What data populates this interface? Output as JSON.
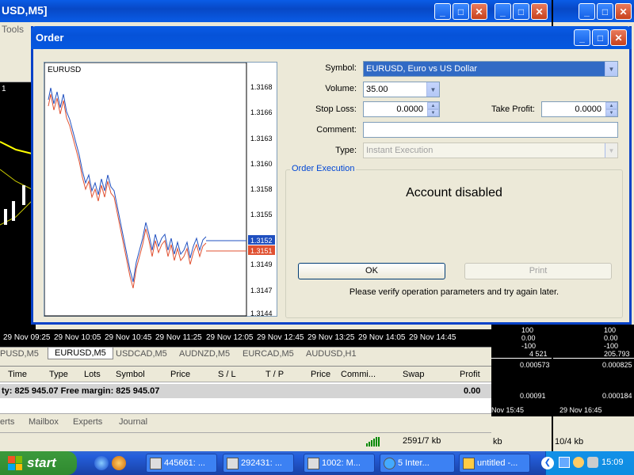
{
  "background_window": {
    "title": "USD,M5]",
    "menu": "Tools",
    "chart_header": "1",
    "time_axis": [
      "29 Nov 09:25",
      "29 Nov 10:05",
      "29 Nov 10:45",
      "29 Nov 11:25",
      "29 Nov 12:05",
      "29 Nov 12:45",
      "29 Nov 13:25",
      "29 Nov 14:05",
      "29 Nov 14:45"
    ],
    "chart_tabs": [
      "PUSD,M5",
      "EURUSD,M5",
      "USDCAD,M5",
      "AUDNZD,M5",
      "EURCAD,M5",
      "AUDUSD,H1"
    ],
    "terminal_headers": [
      "Time",
      "Type",
      "Lots",
      "Symbol",
      "Price",
      "S / L",
      "T / P",
      "Price",
      "Commi...",
      "Swap",
      "Profit"
    ],
    "balance_row": "ty: 825 945.07  Free margin: 825 945.07",
    "balance_profit": "0.00",
    "bottom_tabs": [
      "erts",
      "Mailbox",
      "Experts",
      "Journal"
    ],
    "status_kb": "2591/7 kb"
  },
  "right_windows": {
    "values_a": [
      "100",
      "0.00",
      "-100"
    ],
    "value_a4": "4 521",
    "values_b": [
      "100",
      "0.00",
      "-100"
    ],
    "value_b4": "205.793",
    "osc_a": [
      "0.000573",
      "0.00091"
    ],
    "osc_b": [
      "0.000825",
      "0.000184"
    ],
    "time_a": "Nov 15:45",
    "time_b": "29 Nov 16:45",
    "status_a": "kb",
    "status_b": "10/4 kb"
  },
  "dialog": {
    "title": "Order",
    "chart": {
      "symbol": "EURUSD",
      "price_ticks": [
        "1.3168",
        "1.3166",
        "1.3163",
        "1.3160",
        "1.3158",
        "1.3155",
        "1.3152",
        "1.3151",
        "1.3149",
        "1.3147",
        "1.3144"
      ],
      "ask": "1.3152",
      "bid": "1.3151"
    },
    "labels": {
      "symbol": "Symbol:",
      "volume": "Volume:",
      "stop_loss": "Stop Loss:",
      "take_profit": "Take Profit:",
      "comment": "Comment:",
      "type": "Type:"
    },
    "symbol_value": "EURUSD, Euro vs US Dollar",
    "volume_value": "35.00",
    "stop_loss_value": "0.0000",
    "take_profit_value": "0.0000",
    "comment_value": "",
    "type_value": "Instant Execution",
    "group_label": "Order Execution",
    "message": "Account disabled",
    "ok_label": "OK",
    "print_label": "Print",
    "verify_text": "Please verify operation parameters and try again later."
  },
  "taskbar": {
    "start_label": "start",
    "items": [
      "445661: ...",
      "292431: ...",
      "1002: M...",
      "5 Inter...",
      "untitled -..."
    ],
    "clock": "15:09"
  }
}
